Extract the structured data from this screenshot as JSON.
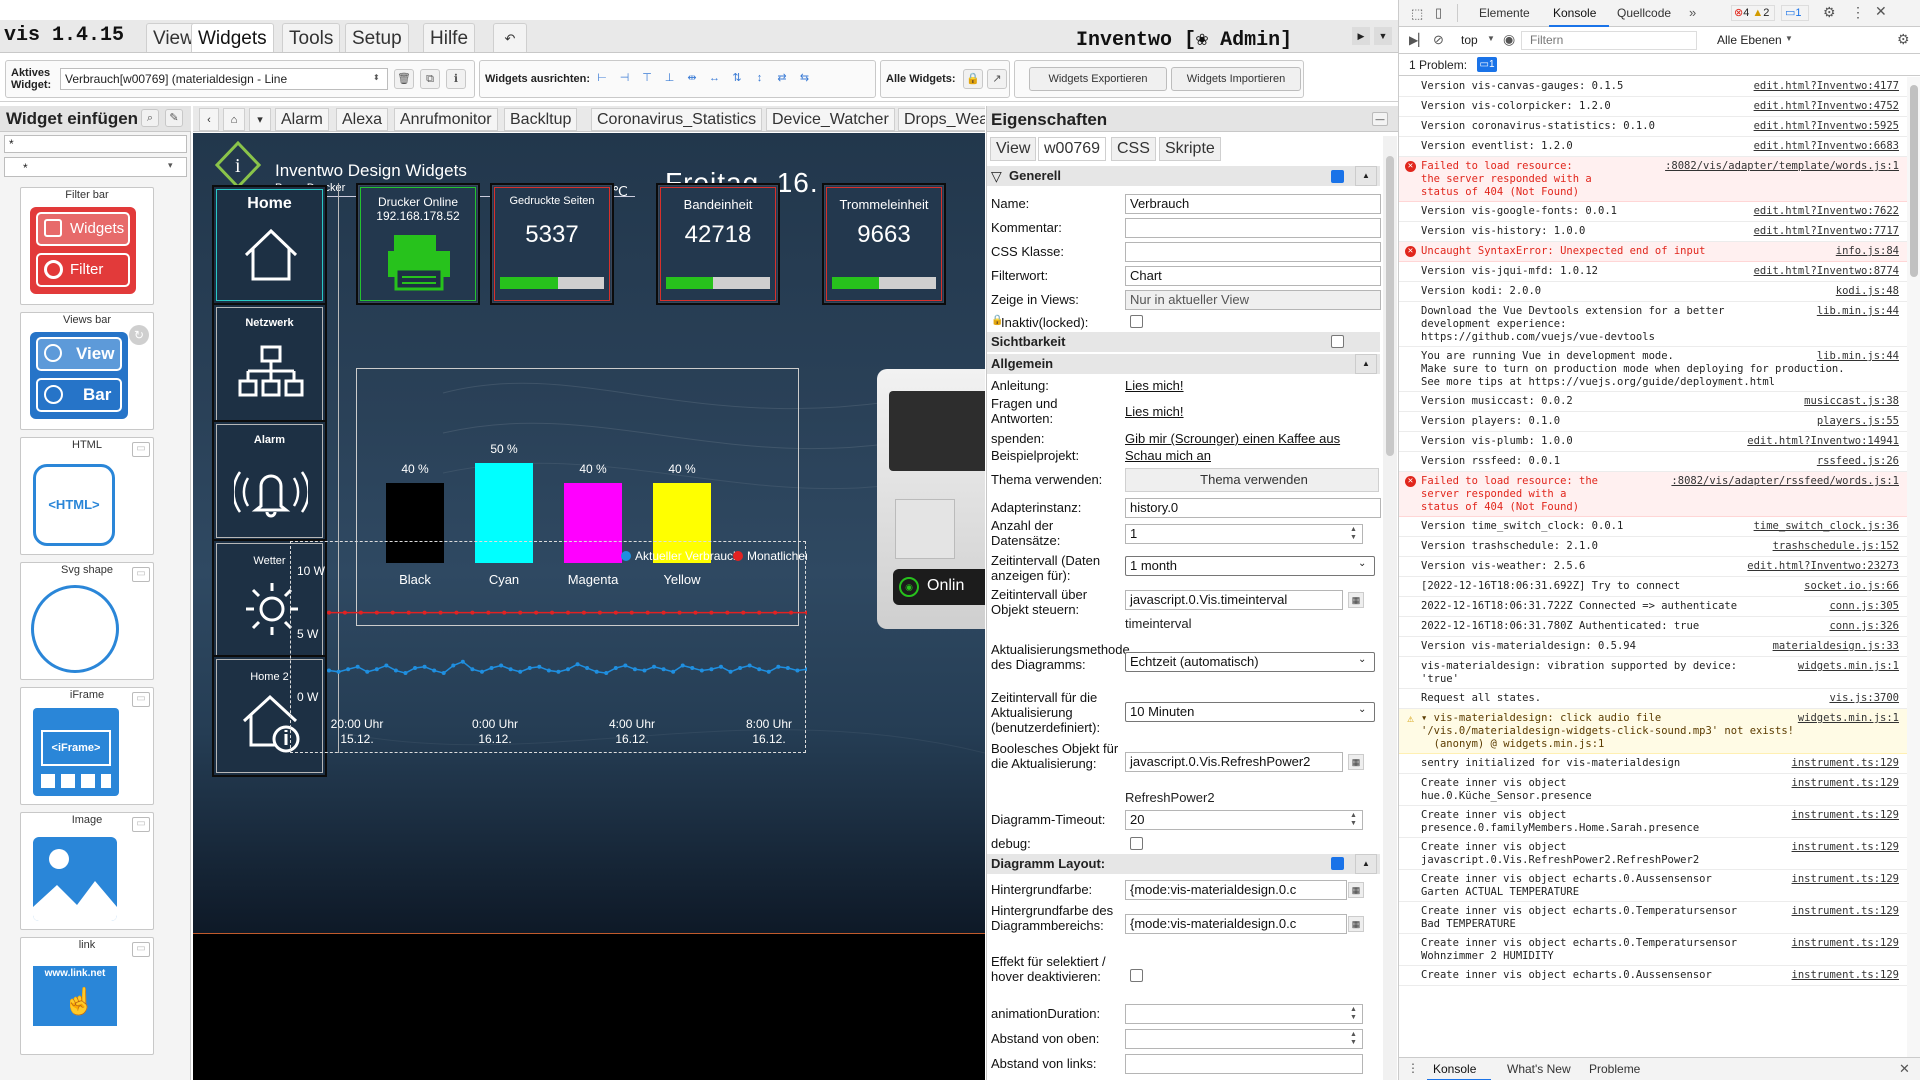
{
  "app": {
    "title": "vis 1.4.15",
    "project": "Inventwo [❀ Admin]"
  },
  "menu": [
    "Views",
    "Widgets",
    "Tools",
    "Setup",
    "Hilfe"
  ],
  "toolbar": {
    "active_widget_label": "Aktives Widget:",
    "active_widget_value": "Verbrauch[w00769] (materialdesign - Line",
    "align_label": "Widgets ausrichten:",
    "all_widgets_label": "Alle Widgets:",
    "export_button": "Widgets Exportieren",
    "import_button": "Widgets Importieren"
  },
  "palette": {
    "title": "Widget einfügen",
    "filter_value": "*",
    "category_value": "*",
    "items": [
      {
        "name": "Filter bar",
        "lines": [
          "Widgets",
          "Filter"
        ]
      },
      {
        "name": "Views bar",
        "lines": [
          "View",
          "Bar"
        ]
      },
      {
        "name": "HTML",
        "lines": [
          "<HTML>"
        ]
      },
      {
        "name": "Svg shape",
        "lines": []
      },
      {
        "name": "iFrame",
        "lines": [
          "<iFrame>"
        ]
      },
      {
        "name": "Image",
        "lines": []
      },
      {
        "name": "link",
        "lines": [
          "www.link.net"
        ]
      }
    ]
  },
  "view_tabs": [
    "Alarm",
    "Alexa",
    "Anrufmonitor",
    "Backltup",
    "Coronavirus_Statistics",
    "Device_Watcher",
    "Drops_Wea"
  ],
  "dashboard": {
    "brand": "Inventwo Design Widgets",
    "page": "Page: Drucker",
    "current_temp": "Aktuell 2.1 ℃",
    "date": "Freitag, 16.",
    "nav": [
      "Home",
      "Netzwerk",
      "Alarm",
      "Wetter",
      "Home 2"
    ],
    "printer_online": {
      "title": "Drucker Online",
      "ip": "192.168.178.52"
    },
    "stats": [
      {
        "title": "Gedruckte Seiten",
        "value": "5337",
        "fill": 0.56
      },
      {
        "title": "Bandeinheit",
        "value": "42718",
        "fill": 0.45
      },
      {
        "title": "Trommeleinheit",
        "value": "9663",
        "fill": 0.45
      }
    ],
    "toner": [
      {
        "label": "Black",
        "percent": "40 %",
        "value": 40,
        "color": "#000000"
      },
      {
        "label": "Cyan",
        "percent": "50 %",
        "value": 50,
        "color": "#00ffff"
      },
      {
        "label": "Magenta",
        "percent": "40 %",
        "value": 40,
        "color": "#ff00ff"
      },
      {
        "label": "Yellow",
        "percent": "40 %",
        "value": 40,
        "color": "#ffff00"
      }
    ],
    "printer_status": "Onlin"
  },
  "chart_data": {
    "type": "line",
    "legend": [
      "Aktueller Verbrauch",
      "Monatlicher"
    ],
    "legend_colors": [
      "#1f8fe0",
      "#e22222"
    ],
    "y_ticks": [
      "10 W",
      "5 W",
      "0 W"
    ],
    "ylim": [
      0,
      10
    ],
    "x_ticks": [
      [
        "20:00 Uhr",
        "15.12."
      ],
      [
        "0:00 Uhr",
        "16.12."
      ],
      [
        "4:00 Uhr",
        "16.12."
      ],
      [
        "8:00 Uhr",
        "16.12."
      ]
    ],
    "series": [
      {
        "name": "Aktueller Verbrauch",
        "color": "#1f8fe0",
        "values": [
          2.1,
          2.0,
          2.2,
          2.4,
          2.0,
          2.2,
          2.5,
          2.1,
          1.9,
          2.3,
          2.4,
          2.1,
          1.9,
          2.5,
          2.8,
          2.2,
          2.0,
          2.3,
          2.5,
          2.2,
          2.0,
          2.3,
          2.4,
          2.1,
          2.0,
          2.2,
          2.6,
          2.3,
          2.0,
          1.9,
          2.3,
          2.5,
          2.2,
          2.1,
          2.4,
          2.2,
          2.0,
          2.5,
          2.3,
          2.1,
          2.2,
          2.4,
          2.0,
          2.3,
          2.5,
          2.2,
          2.0,
          2.4,
          2.3,
          2.1,
          2.2
        ]
      },
      {
        "name": "Monatlicher",
        "color": "#e22222",
        "values": [
          6.7,
          6.7,
          6.7,
          6.7,
          6.7,
          6.7,
          6.7,
          6.7,
          6.7,
          6.7,
          6.7,
          6.7,
          6.7,
          6.7,
          6.7,
          6.7,
          6.7,
          6.7,
          6.7,
          6.7,
          6.7,
          6.7,
          6.7,
          6.7,
          6.7,
          6.7,
          6.7,
          6.7,
          6.7,
          6.7,
          6.7
        ]
      }
    ]
  },
  "props": {
    "title": "Eigenschaften",
    "tabs": [
      "View",
      "w00769",
      "CSS",
      "Skripte"
    ],
    "sections": {
      "generell": "Generell",
      "sichtbarkeit": "Sichtbarkeit",
      "allgemein": "Allgemein",
      "layout": "Diagramm Layout:"
    },
    "name_label": "Name:",
    "name_value": "Verbrauch",
    "comment_label": "Kommentar:",
    "css_label": "CSS Klasse:",
    "filter_label": "Filterwort:",
    "filter_value": "Chart",
    "views_label": "Zeige in Views:",
    "views_value": "Nur in aktueller View",
    "locked_label": "Inaktiv(locked):",
    "manual_label": "Anleitung:",
    "manual_link": "Lies mich!",
    "questions_label": "Fragen und Antworten:",
    "questions_link": "Lies mich!",
    "donate_label": "spenden:",
    "donate_link": "Gib mir (Scrounger) einen Kaffee aus",
    "example_label": "Beispielprojekt:",
    "example_link": "Schau mich an",
    "theme_label": "Thema verwenden:",
    "theme_button": "Thema verwenden",
    "adapter_label": "Adapterinstanz:",
    "adapter_value": "history.0",
    "count_label": "Anzahl der Datensätze:",
    "count_value": "1",
    "interval_label": "Zeitintervall (Daten anzeigen für):",
    "interval_value": "1 month",
    "interval_obj_label": "Zeitintervall über Objekt steuern:",
    "interval_obj_value": "javascript.0.Vis.timeinterval",
    "interval_obj_sub": "timeinterval",
    "update_method_label": "Aktualisierungsmethode des Diagramms:",
    "update_method_value": "Echtzeit (automatisch)",
    "update_interval_label": "Zeitintervall für die Aktualisierung (benutzerdefiniert):",
    "update_interval_value": "10 Minuten",
    "bool_obj_label": "Boolesches Objekt für die Aktualisierung:",
    "bool_obj_value": "javascript.0.Vis.RefreshPower2",
    "bool_obj_sub": "RefreshPower2",
    "timeout_label": "Diagramm-Timeout:",
    "timeout_value": "20",
    "debug_label": "debug:",
    "bg_label": "Hintergrundfarbe:",
    "bg_value": "{mode:vis-materialdesign.0.c",
    "bg_area_label": "Hintergrundfarbe des Diagrammbereichs:",
    "bg_area_value": "{mode:vis-materialdesign.0.c",
    "hover_label": "Effekt für selektiert / hover deaktivieren:",
    "anim_label": "animationDuration:",
    "margin_top_label": "Abstand von oben:",
    "margin_left_label": "Abstand von links:"
  },
  "devtools": {
    "tabs": [
      "Elemente",
      "Konsole",
      "Quellcode"
    ],
    "badges": {
      "errors": "4",
      "warnings": "2",
      "messages": "1"
    },
    "context": "top",
    "filter_placeholder": "Filtern",
    "levels": "Alle Ebenen",
    "issues": "1 Problem:",
    "issues_count": "1",
    "bottom_tabs": [
      "Konsole",
      "What's New",
      "Probleme"
    ],
    "lines": [
      {
        "t": "normal",
        "text": "Version vis-canvas-gauges: 0.1.5",
        "src": "edit.html?Inventwo:4177"
      },
      {
        "t": "normal",
        "text": "Version vis-colorpicker: 1.2.0",
        "src": "edit.html?Inventwo:4752"
      },
      {
        "t": "normal",
        "text": "Version coronavirus-statistics: 0.1.0",
        "src": "edit.html?Inventwo:5925"
      },
      {
        "t": "normal",
        "text": "Version eventlist: 1.2.0",
        "src": "edit.html?Inventwo:6683"
      },
      {
        "t": "error",
        "text": "Failed to load resource:\nthe server responded with a\nstatus of 404 (Not Found)",
        "src": ":8082/vis/adapter/template/words.js:1"
      },
      {
        "t": "normal",
        "text": "Version vis-google-fonts: 0.0.1",
        "src": "edit.html?Inventwo:7622"
      },
      {
        "t": "normal",
        "text": "Version vis-history: 1.0.0",
        "src": "edit.html?Inventwo:7717"
      },
      {
        "t": "error",
        "text": "Uncaught SyntaxError: Unexpected end of input",
        "src": "info.js:84"
      },
      {
        "t": "normal",
        "text": "Version vis-jqui-mfd: 1.0.12",
        "src": "edit.html?Inventwo:8774"
      },
      {
        "t": "normal",
        "text": "Version kodi: 2.0.0",
        "src": "kodi.js:48"
      },
      {
        "t": "normal",
        "text": "Download the Vue Devtools extension for a better\ndevelopment experience:\nhttps://github.com/vuejs/vue-devtools",
        "src": "lib.min.js:44"
      },
      {
        "t": "normal",
        "text": "You are running Vue in development mode.\nMake sure to turn on production mode when deploying for production.\nSee more tips at https://vuejs.org/guide/deployment.html",
        "src": "lib.min.js:44"
      },
      {
        "t": "normal",
        "text": "Version musiccast: 0.0.2",
        "src": "musiccast.js:38"
      },
      {
        "t": "normal",
        "text": "Version players: 0.1.0",
        "src": "players.js:55"
      },
      {
        "t": "normal",
        "text": "Version vis-plumb: 1.0.0",
        "src": "edit.html?Inventwo:14941"
      },
      {
        "t": "normal",
        "text": "Version rssfeed: 0.0.1",
        "src": "rssfeed.js:26"
      },
      {
        "t": "error",
        "text": "Failed to load resource: the\nserver responded with a\nstatus of 404 (Not Found)",
        "src": ":8082/vis/adapter/rssfeed/words.js:1"
      },
      {
        "t": "normal",
        "text": "Version time_switch_clock: 0.0.1",
        "src": "time_switch_clock.js:36"
      },
      {
        "t": "normal",
        "text": "Version trashschedule: 2.1.0",
        "src": "trashschedule.js:152"
      },
      {
        "t": "normal",
        "text": "Version vis-weather: 2.5.6",
        "src": "edit.html?Inventwo:23273"
      },
      {
        "t": "normal",
        "text": "[2022-12-16T18:06:31.692Z] Try to connect",
        "src": "socket.io.js:66"
      },
      {
        "t": "normal",
        "text": "2022-12-16T18:06:31.722Z Connected => authenticate",
        "src": "conn.js:305"
      },
      {
        "t": "normal",
        "text": "2022-12-16T18:06:31.780Z Authenticated: true",
        "src": "conn.js:326"
      },
      {
        "t": "normal",
        "text": "Version vis-materialdesign: 0.5.94",
        "src": "materialdesign.js:33"
      },
      {
        "t": "normal",
        "text": "vis-materialdesign: vibration supported by device:\n'true'",
        "src": "widgets.min.js:1"
      },
      {
        "t": "normal",
        "text": "Request all states.",
        "src": "vis.js:3700"
      },
      {
        "t": "warn",
        "text": "▾ vis-materialdesign: click audio file\n'/vis.0/materialdesign-widgets-click-sound.mp3' not exists!\n  (anonym) @ widgets.min.js:1",
        "src": "widgets.min.js:1"
      },
      {
        "t": "normal",
        "text": "sentry initialized for vis-materialdesign",
        "src": "instrument.ts:129"
      },
      {
        "t": "normal",
        "text": "Create inner vis object\nhue.0.Küche_Sensor.presence",
        "src": "instrument.ts:129"
      },
      {
        "t": "normal",
        "text": "Create inner vis object\npresence.0.familyMembers.Home.Sarah.presence",
        "src": "instrument.ts:129"
      },
      {
        "t": "normal",
        "text": "Create inner vis object\njavascript.0.Vis.RefreshPower2.RefreshPower2",
        "src": "instrument.ts:129"
      },
      {
        "t": "normal",
        "text": "Create inner vis object echarts.0.Aussensensor\nGarten ACTUAL TEMPERATURE",
        "src": "instrument.ts:129"
      },
      {
        "t": "normal",
        "text": "Create inner vis object echarts.0.Temperatursensor\nBad TEMPERATURE",
        "src": "instrument.ts:129"
      },
      {
        "t": "normal",
        "text": "Create inner vis object echarts.0.Temperatursensor\nWohnzimmer 2 HUMIDITY",
        "src": "instrument.ts:129"
      },
      {
        "t": "normal",
        "text": "Create inner vis object echarts.0.Aussensensor",
        "src": "instrument.ts:129"
      }
    ]
  }
}
